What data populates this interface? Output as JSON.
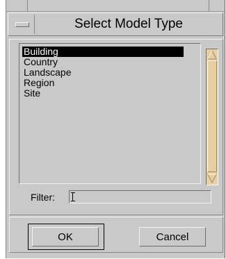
{
  "dialog": {
    "title": "Select Model Type"
  },
  "list": {
    "items": [
      "Building",
      "Country",
      "Landscape",
      "Region",
      "Site"
    ],
    "selected_index": 0
  },
  "filter": {
    "label": "Filter:",
    "value": ""
  },
  "buttons": {
    "ok_label": "OK",
    "cancel_label": "Cancel"
  },
  "colors": {
    "window_bg": "#c9c9c9",
    "scrollbar": "#e7cfa3",
    "selection_bg": "#000000"
  }
}
